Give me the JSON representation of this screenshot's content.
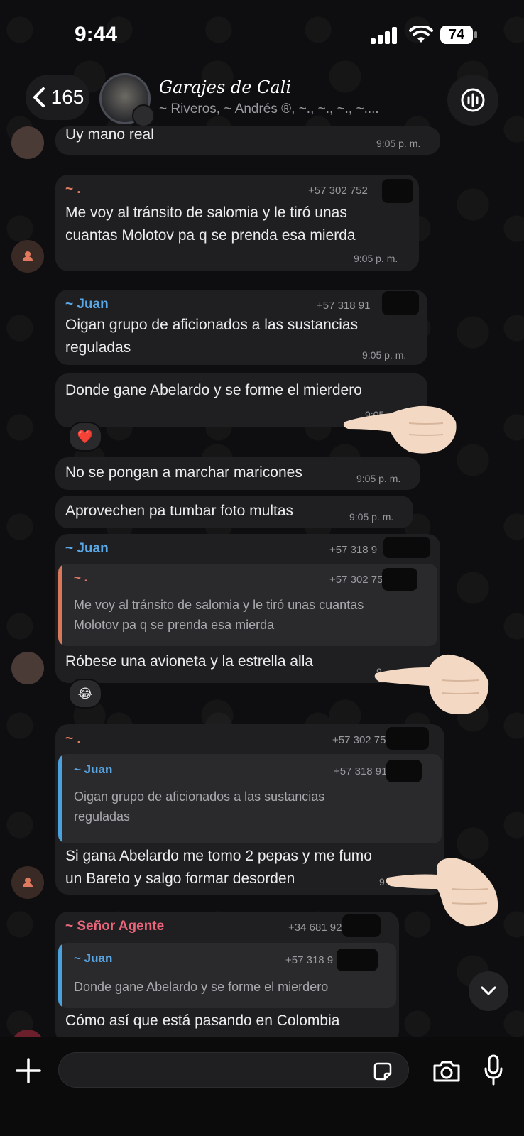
{
  "status_bar": {
    "time": "9:44",
    "battery": "74"
  },
  "header": {
    "back_count": "165",
    "group_name": "Garajes de Cali",
    "members": "~ Riveros, ~  Andrés ®, ~., ~., ~., ~...."
  },
  "messages": [
    {
      "text": "Uy mano real",
      "time": "9:05 p. m."
    },
    {
      "sender": "~ .",
      "phone": "+57 302 752",
      "text_lines": [
        "Me voy al tránsito de salomia y le tiró unas",
        "cuantas Molotov pa q se prenda esa mierda"
      ],
      "time": "9:05 p. m."
    },
    {
      "sender": "~ Juan",
      "phone": "+57 318 91",
      "text_lines": [
        "Oigan grupo de aficionados a las sustancias",
        "reguladas"
      ],
      "time": "9:05 p. m."
    },
    {
      "text": "Donde gane Abelardo y se forme el mierdero",
      "time": "9:05",
      "reaction": "❤️"
    },
    {
      "text": "No se pongan a marchar maricones",
      "time": "9:05 p. m."
    },
    {
      "text": "Aprovechen pa tumbar foto multas",
      "time": "9:05 p. m."
    },
    {
      "sender": "~ Juan",
      "phone": "+57 318 9",
      "quote": {
        "sender": "~ .",
        "phone": "+57 302 75",
        "lines": [
          "Me voy al tránsito de salomia y le tiró unas cuantas",
          "Molotov pa q se prenda esa mierda"
        ]
      },
      "text": "Róbese una avioneta y la estrella alla",
      "time": "9",
      "reaction": "😂"
    },
    {
      "sender": "~ .",
      "phone": "+57 302 75",
      "quote": {
        "sender": "~ Juan",
        "phone": "+57 318 91",
        "lines": [
          "Oigan grupo de aficionados a las sustancias",
          "reguladas"
        ]
      },
      "text_lines": [
        "Si gana Abelardo me tomo 2 pepas y me fumo",
        "un Bareto y salgo formar desorden"
      ],
      "time": "9:0"
    },
    {
      "sender": "~ Señor Agente",
      "phone": "+34 681 92",
      "quote": {
        "sender": "~ Juan",
        "phone": "+57 318 9",
        "lines": [
          "Donde gane Abelardo y se forme el mierdero"
        ]
      },
      "text": "Cómo así que está pasando en Colombia"
    }
  ],
  "composer": {
    "placeholder": ""
  },
  "colors": {
    "accent_blue": "#5aa7e6",
    "sender_orange": "#e07a5f",
    "sender_red": "#e8657a",
    "quote_bar_orange": "#d9795b",
    "quote_bar_blue": "#4aa3e0",
    "bubble": "#1f1f21"
  },
  "icons": [
    "chevron-left-icon",
    "voice-chat-icon",
    "plus-icon",
    "sticker-icon",
    "camera-icon",
    "microphone-icon",
    "chevron-down-icon",
    "person-icon"
  ]
}
